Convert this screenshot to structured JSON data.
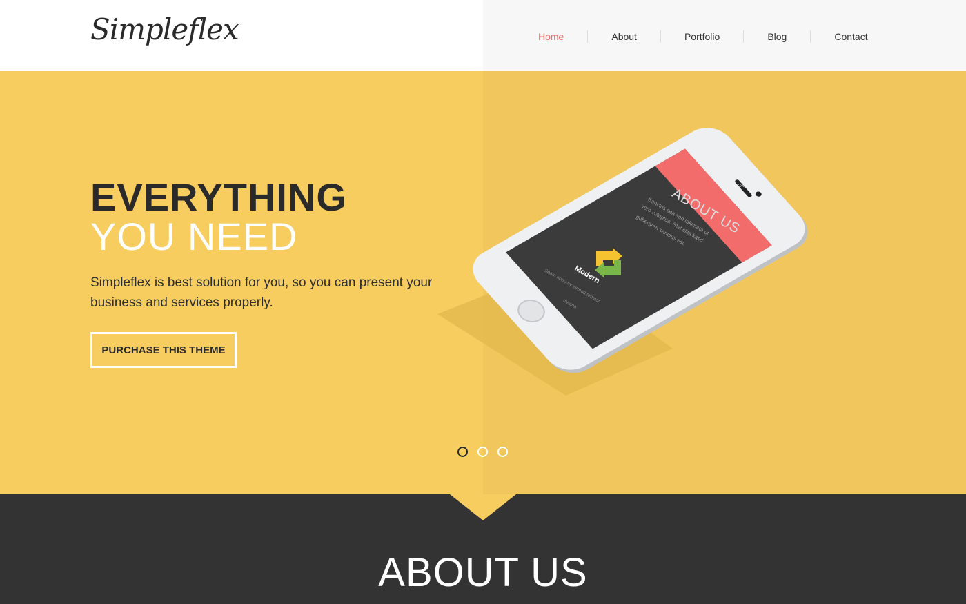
{
  "brand": {
    "logo_text": "Simpleflex"
  },
  "nav": {
    "items": [
      {
        "label": "Home",
        "active": true
      },
      {
        "label": "About",
        "active": false
      },
      {
        "label": "Portfolio",
        "active": false
      },
      {
        "label": "Blog",
        "active": false
      },
      {
        "label": "Contact",
        "active": false
      }
    ]
  },
  "hero": {
    "title_line1": "EVERYTHING",
    "title_line2": "YOU NEED",
    "description": "Simpleflex is best solution for you, so you can present your business and services properly.",
    "cta_label": "PURCHASE THIS THEME",
    "slider": {
      "count": 3,
      "active_index": 0
    }
  },
  "phone_screen": {
    "header_icon": "three-dots-icon",
    "heading": "ABOUT US",
    "body_line1": "Sanctus sea sed takimata ut",
    "body_line2": "vero voluptua. Stet clita kasd",
    "body_line3": "gubergren sanctus est.",
    "card_title": "Modern",
    "card_text_line1": "Seam nonumy eirmod tempor",
    "card_text_line2": "magna",
    "card_icon": "refresh-arrows-icon"
  },
  "about": {
    "title": "ABOUT US"
  },
  "colors": {
    "accent": "#f36c6c",
    "hero_yellow": "#f8cd5f",
    "dark": "#333333",
    "white": "#ffffff"
  }
}
